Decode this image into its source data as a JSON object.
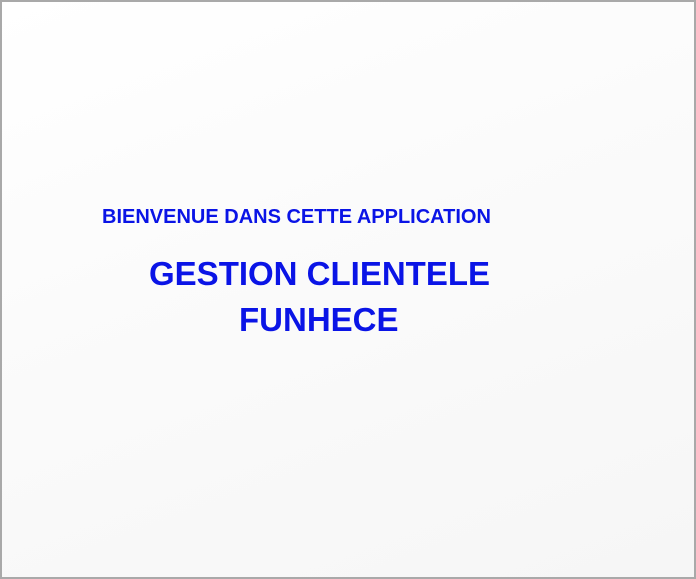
{
  "welcome_text": "BIENVENUE DANS CETTE APPLICATION",
  "title_line_1": "GESTION CLIENTELE",
  "title_line_2": "FUNHECE",
  "colors": {
    "text": "#0a14e6",
    "border": "#a9a9a9",
    "background": "#ffffff"
  }
}
